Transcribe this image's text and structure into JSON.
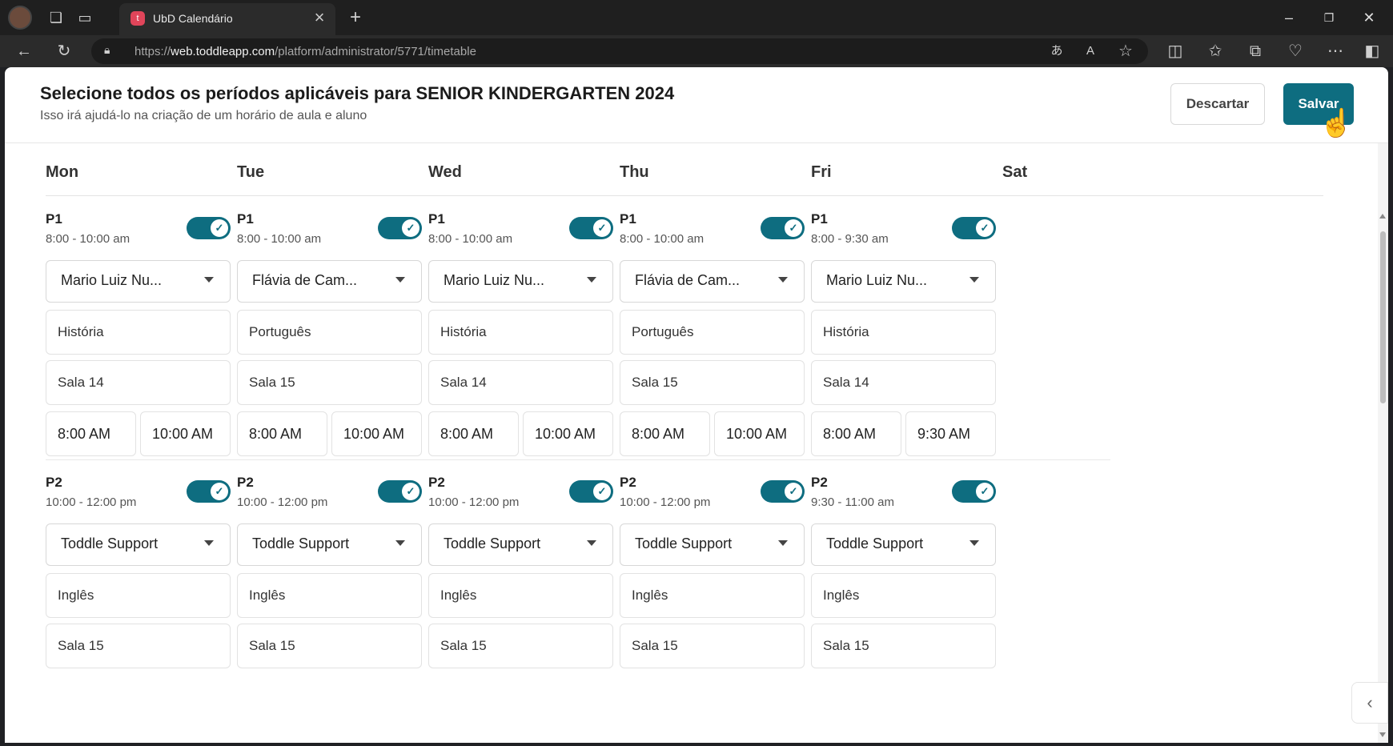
{
  "browser": {
    "tab_title": "UbD Calendário",
    "tab_favicon_letter": "t",
    "url_prefix": "https://",
    "url_domain": "web.toddleapp.com",
    "url_path": "/platform/administrator/5771/timetable"
  },
  "header": {
    "title": "Selecione todos os períodos aplicáveis para SENIOR KINDERGARTEN 2024",
    "subtitle": "Isso irá ajudá-lo na criação de um horário de aula e aluno",
    "discard_label": "Descartar",
    "save_label": "Salvar"
  },
  "days": [
    "Mon",
    "Tue",
    "Wed",
    "Thu",
    "Fri",
    "Sat"
  ],
  "periods": {
    "p1": [
      {
        "label": "P1",
        "time": "8:00 - 10:00 am",
        "enabled": true,
        "teacher": "Mario Luiz Nu...",
        "subject": "História",
        "room": "Sala 14",
        "start": "8:00 AM",
        "end": "10:00 AM"
      },
      {
        "label": "P1",
        "time": "8:00 - 10:00 am",
        "enabled": true,
        "teacher": "Flávia de Cam...",
        "subject": "Português",
        "room": "Sala 15",
        "start": "8:00 AM",
        "end": "10:00 AM"
      },
      {
        "label": "P1",
        "time": "8:00 - 10:00 am",
        "enabled": true,
        "teacher": "Mario Luiz Nu...",
        "subject": "História",
        "room": "Sala 14",
        "start": "8:00 AM",
        "end": "10:00 AM"
      },
      {
        "label": "P1",
        "time": "8:00 - 10:00 am",
        "enabled": true,
        "teacher": "Flávia de Cam...",
        "subject": "Português",
        "room": "Sala 15",
        "start": "8:00 AM",
        "end": "10:00 AM"
      },
      {
        "label": "P1",
        "time": "8:00 - 9:30 am",
        "enabled": true,
        "teacher": "Mario Luiz Nu...",
        "subject": "História",
        "room": "Sala 14",
        "start": "8:00 AM",
        "end": "9:30 AM"
      }
    ],
    "p2": [
      {
        "label": "P2",
        "time": "10:00 - 12:00 pm",
        "enabled": true,
        "teacher": "Toddle Support",
        "subject": "Inglês",
        "room": "Sala 15"
      },
      {
        "label": "P2",
        "time": "10:00 - 12:00 pm",
        "enabled": true,
        "teacher": "Toddle Support",
        "subject": "Inglês",
        "room": "Sala 15"
      },
      {
        "label": "P2",
        "time": "10:00 - 12:00 pm",
        "enabled": true,
        "teacher": "Toddle Support",
        "subject": "Inglês",
        "room": "Sala 15"
      },
      {
        "label": "P2",
        "time": "10:00 - 12:00 pm",
        "enabled": true,
        "teacher": "Toddle Support",
        "subject": "Inglês",
        "room": "Sala 15"
      },
      {
        "label": "P2",
        "time": "9:30 - 11:00 am",
        "enabled": true,
        "teacher": "Toddle Support",
        "subject": "Inglês",
        "room": "Sala 15"
      }
    ]
  },
  "colors": {
    "accent": "#0e6d80",
    "border": "#e2e2e2"
  }
}
